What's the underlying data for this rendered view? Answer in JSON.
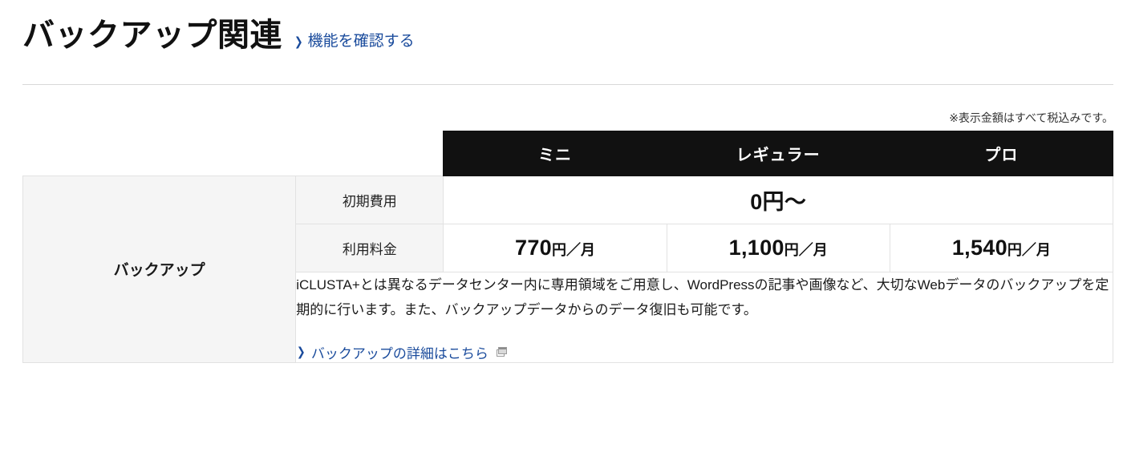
{
  "header": {
    "title": "バックアップ関連",
    "link_label": "機能を確認する",
    "chevron": "❯"
  },
  "tax_note": "※表示金額はすべて税込みです。",
  "table": {
    "plans": [
      "ミニ",
      "レギュラー",
      "プロ"
    ],
    "rows": {
      "initial_cost": {
        "label": "初期費用",
        "merged_value": "0円〜"
      },
      "usage_fee": {
        "label": "利用料金",
        "values": [
          {
            "amount": "770",
            "unit": "円／月"
          },
          {
            "amount": "1,100",
            "unit": "円／月"
          },
          {
            "amount": "1,540",
            "unit": "円／月"
          }
        ]
      },
      "feature": {
        "group_label": "バックアップ",
        "description": "iCLUSTA+とは異なるデータセンター内に専用領域をご用意し、WordPressの記事や画像など、大切なWebデータのバックアップを定期的に行います。また、バックアップデータからのデータ復旧も可能です。",
        "detail_link": "バックアップの詳細はこちら",
        "chevron": "❯"
      }
    }
  },
  "colors": {
    "link": "#1a4b9c",
    "header_bg": "#111111",
    "label_bg": "#f5f5f5",
    "border": "#e2e2e2"
  }
}
